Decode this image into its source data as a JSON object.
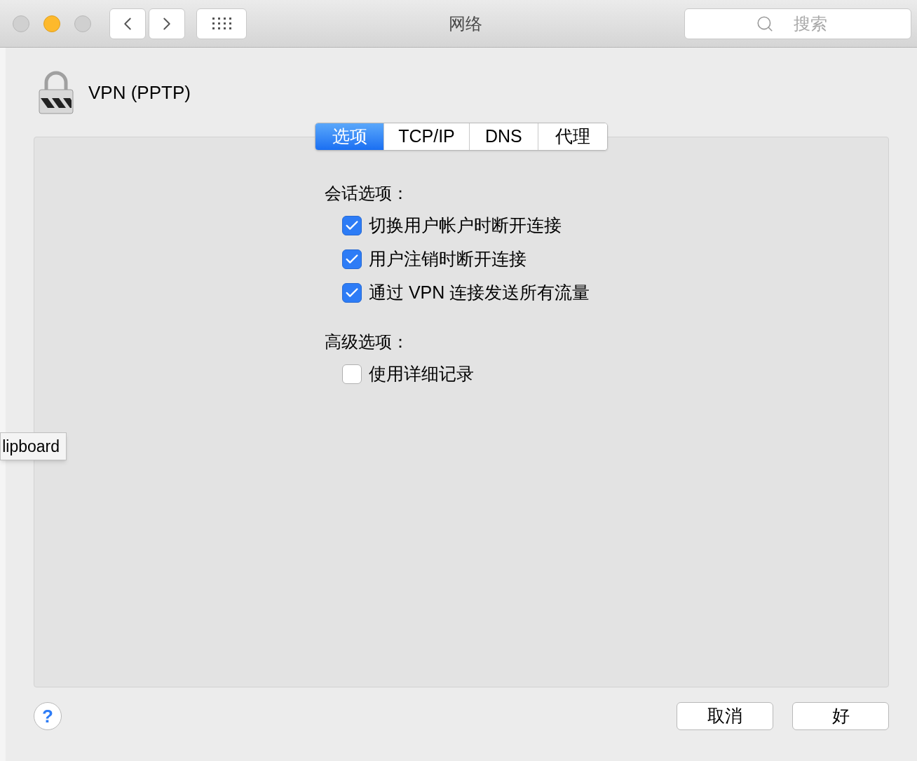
{
  "window": {
    "title": "网络"
  },
  "search": {
    "placeholder": "搜索"
  },
  "service": {
    "name": "VPN (PPTP)"
  },
  "tabs": [
    {
      "label": "选项",
      "selected": true
    },
    {
      "label": "TCP/IP",
      "selected": false
    },
    {
      "label": "DNS",
      "selected": false
    },
    {
      "label": "代理",
      "selected": false
    }
  ],
  "sections": [
    {
      "heading": "会话选项：",
      "options": [
        {
          "label": "切换用户帐户时断开连接",
          "checked": true
        },
        {
          "label": "用户注销时断开连接",
          "checked": true
        },
        {
          "label": "通过 VPN 连接发送所有流量",
          "checked": true
        }
      ]
    },
    {
      "heading": "高级选项：",
      "options": [
        {
          "label": "使用详细记录",
          "checked": false
        }
      ]
    }
  ],
  "tooltip": "lipboard",
  "help": "?",
  "buttons": [
    {
      "label": "取消"
    },
    {
      "label": "好"
    }
  ]
}
